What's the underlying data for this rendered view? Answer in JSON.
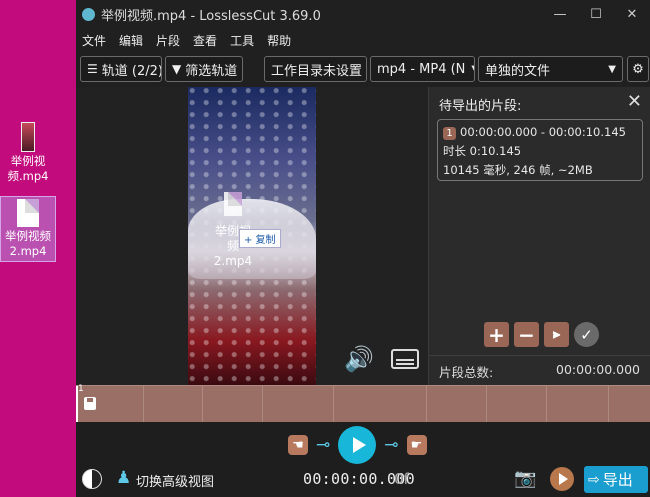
{
  "desktop": {
    "icons": [
      {
        "label": "举例视频.mp4"
      },
      {
        "label": "举例视频2.mp4"
      }
    ]
  },
  "window": {
    "title": "举例视频.mp4 - LosslessCut 3.69.0",
    "controls": {
      "minimize": "—",
      "maximize": "☐",
      "close": "✕"
    }
  },
  "menu": [
    "文件",
    "编辑",
    "片段",
    "查看",
    "工具",
    "帮助"
  ],
  "toolbar": {
    "tracks": "轨道 (2/2)",
    "filter_tracks": "筛选轨道",
    "workdir": "工作目录未设置",
    "format": "mp4 - MP4 (N",
    "output_mode": "单独的文件"
  },
  "player": {
    "drag_file_label": "举例视频2.mp4",
    "copy_tooltip": "+ 复制"
  },
  "panel": {
    "title": "待导出的片段:",
    "segment": {
      "index": "1",
      "range": "00:00:00.000 - 00:00:10.145",
      "duration": "时长 0:10.145",
      "details": "10145 毫秒, 246 帧, ~2MB"
    },
    "total_label": "片段总数:",
    "total_value": "00:00:00.000"
  },
  "timeline": {
    "segment_number": "1"
  },
  "controls": {
    "advanced_view": "切换高级视图",
    "timecode": "00:00:00.000",
    "frame": "0f",
    "export": "导出"
  },
  "colors": {
    "desktop_bg": "#c20b7c",
    "accent": "#18b6d8",
    "segment": "#9a7066"
  }
}
